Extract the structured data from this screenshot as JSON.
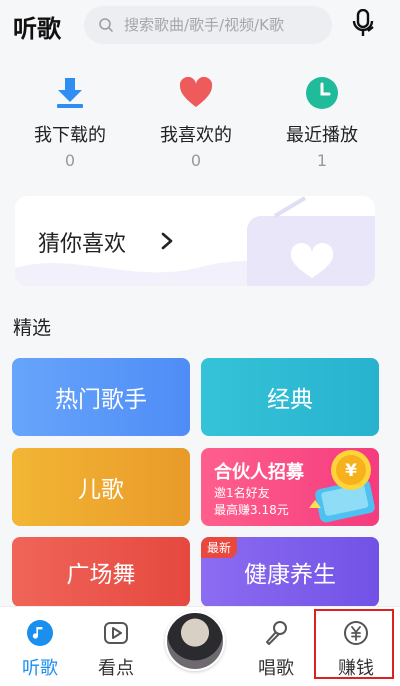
{
  "header": {
    "title": "听歌",
    "search_placeholder": "搜索歌曲/歌手/视频/K歌"
  },
  "quick_access": [
    {
      "label": "我下载的",
      "count": "0",
      "icon": "download-icon",
      "color": "#2f8df3"
    },
    {
      "label": "我喜欢的",
      "count": "0",
      "icon": "heart-icon",
      "color": "#ee5b5b"
    },
    {
      "label": "最近播放",
      "count": "1",
      "icon": "clock-icon",
      "color": "#1fbb9b"
    }
  ],
  "guess": {
    "label": "猜你喜欢"
  },
  "section": {
    "title": "精选"
  },
  "cards": {
    "hot_singers": "热门歌手",
    "classic": "经典",
    "kids": "儿歌",
    "partner_title": "合伙人招募",
    "partner_sub1": "邀1名好友",
    "partner_sub2": "最高赚3.18元",
    "square_dance": "广场舞",
    "health": "健康养生",
    "health_badge": "最新"
  },
  "tabs": [
    {
      "label": "听歌",
      "icon": "music-note-icon",
      "active": true
    },
    {
      "label": "看点",
      "icon": "play-icon",
      "active": false
    },
    {
      "label": "唱歌",
      "icon": "microphone-icon",
      "active": false
    },
    {
      "label": "赚钱",
      "icon": "yuan-coin-icon",
      "active": false
    }
  ],
  "colors": {
    "accent": "#1b8fef",
    "highlight_box": "#e02020"
  }
}
